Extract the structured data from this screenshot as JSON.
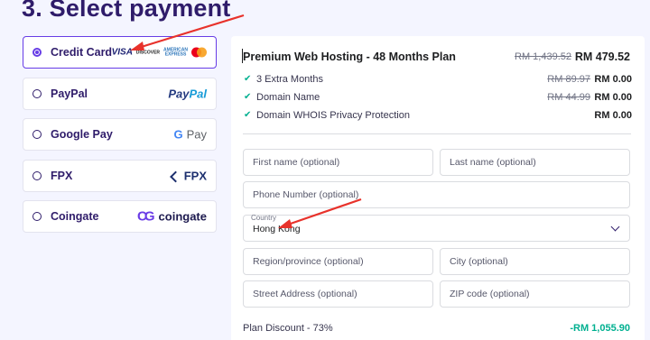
{
  "heading": "3. Select payment",
  "payment_methods": [
    {
      "label": "Credit Card",
      "selected": true
    },
    {
      "label": "PayPal",
      "selected": false
    },
    {
      "label": "Google Pay",
      "selected": false
    },
    {
      "label": "FPX",
      "selected": false
    },
    {
      "label": "Coingate",
      "selected": false
    }
  ],
  "logos": {
    "visa": "VISA",
    "discover": "DISCOVER",
    "amex_line1": "AMERICAN",
    "amex_line2": "EXPRESS",
    "paypal_1": "Pay",
    "paypal_2": "Pal",
    "gpay_g": "G",
    "gpay_text": "Pay",
    "fpx": "FPX",
    "coingate_mark": "CG",
    "coingate": "coingate"
  },
  "plan": {
    "title": "Premium Web Hosting - 48 Months Plan",
    "old_price": "RM 1,439.52",
    "price": "RM 479.52"
  },
  "features": [
    {
      "label": "3 Extra Months",
      "old": "RM 89.97",
      "price": "RM 0.00"
    },
    {
      "label": "Domain Name",
      "old": "RM 44.99",
      "price": "RM 0.00"
    },
    {
      "label": "Domain WHOIS Privacy Protection",
      "old": "",
      "price": "RM 0.00"
    }
  ],
  "form": {
    "first_name": "First name (optional)",
    "last_name": "Last name (optional)",
    "phone": "Phone Number (optional)",
    "country_label": "Country",
    "country_value": "Hong Kong",
    "region": "Region/province (optional)",
    "city": "City (optional)",
    "street": "Street Address (optional)",
    "zip": "ZIP code (optional)"
  },
  "discount": {
    "label": "Plan Discount - 73%",
    "value": "-RM 1,055.90"
  },
  "colors": {
    "accent": "#673de6",
    "heading": "#2f1c6a",
    "success": "#00b090",
    "annotation_arrow": "#e8322b"
  }
}
